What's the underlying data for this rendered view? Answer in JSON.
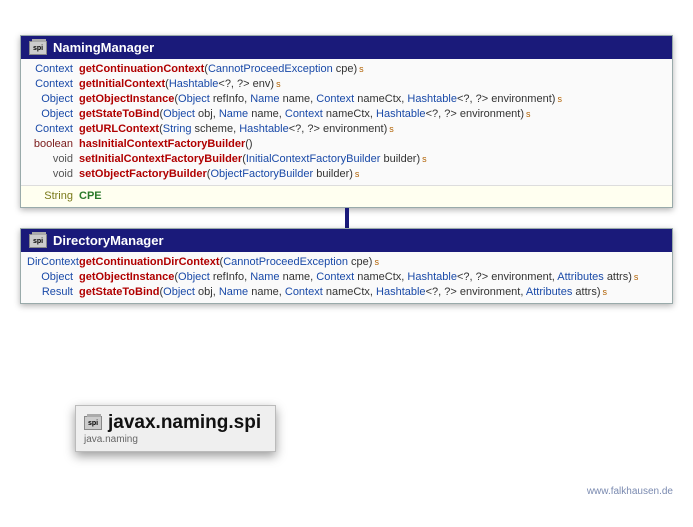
{
  "classes": [
    {
      "name": "NamingManager",
      "methods": [
        {
          "ret": "Context",
          "retKind": "type",
          "name": "getContinuationContext",
          "static": true,
          "params": [
            {
              "type": "CannotProceedException",
              "name": "cpe"
            }
          ]
        },
        {
          "ret": "Context",
          "retKind": "type",
          "name": "getInitialContext",
          "static": true,
          "params": [
            {
              "type": "Hashtable",
              "gen": "<?, ?>",
              "name": "env"
            }
          ]
        },
        {
          "ret": "Object",
          "retKind": "type",
          "name": "getObjectInstance",
          "static": true,
          "params": [
            {
              "type": "Object",
              "name": "refInfo"
            },
            {
              "type": "Name",
              "name": "name"
            },
            {
              "type": "Context",
              "name": "nameCtx"
            },
            {
              "type": "Hashtable",
              "gen": "<?, ?>",
              "name": "environment"
            }
          ]
        },
        {
          "ret": "Object",
          "retKind": "type",
          "name": "getStateToBind",
          "static": true,
          "params": [
            {
              "type": "Object",
              "name": "obj"
            },
            {
              "type": "Name",
              "name": "name"
            },
            {
              "type": "Context",
              "name": "nameCtx"
            },
            {
              "type": "Hashtable",
              "gen": "<?, ?>",
              "name": "environment"
            }
          ]
        },
        {
          "ret": "Context",
          "retKind": "type",
          "name": "getURLContext",
          "static": true,
          "params": [
            {
              "type": "String",
              "name": "scheme"
            },
            {
              "type": "Hashtable",
              "gen": "<?, ?>",
              "name": "environment"
            }
          ]
        },
        {
          "ret": "boolean",
          "retKind": "keyword",
          "name": "hasInitialContextFactoryBuilder",
          "static": false,
          "params": []
        },
        {
          "ret": "void",
          "retKind": "void",
          "name": "setInitialContextFactoryBuilder",
          "static": true,
          "params": [
            {
              "type": "InitialContextFactoryBuilder",
              "name": "builder"
            }
          ]
        },
        {
          "ret": "void",
          "retKind": "void",
          "name": "setObjectFactoryBuilder",
          "static": true,
          "params": [
            {
              "type": "ObjectFactoryBuilder",
              "name": "builder"
            }
          ]
        }
      ],
      "fields": [
        {
          "type": "String",
          "name": "CPE"
        }
      ]
    },
    {
      "name": "DirectoryManager",
      "methods": [
        {
          "ret": "DirContext",
          "retKind": "type",
          "name": "getContinuationDirContext",
          "static": true,
          "params": [
            {
              "type": "CannotProceedException",
              "name": "cpe"
            }
          ]
        },
        {
          "ret": "Object",
          "retKind": "type",
          "name": "getObjectInstance",
          "static": true,
          "params": [
            {
              "type": "Object",
              "name": "refInfo"
            },
            {
              "type": "Name",
              "name": "name"
            },
            {
              "type": "Context",
              "name": "nameCtx"
            },
            {
              "type": "Hashtable",
              "gen": "<?, ?>",
              "name": "environment"
            },
            {
              "type": "Attributes",
              "name": "attrs"
            }
          ]
        },
        {
          "ret": "Result",
          "retKind": "type",
          "name": "getStateToBind",
          "static": true,
          "params": [
            {
              "type": "Object",
              "name": "obj"
            },
            {
              "type": "Name",
              "name": "name"
            },
            {
              "type": "Context",
              "name": "nameCtx"
            },
            {
              "type": "Hashtable",
              "gen": "<?, ?>",
              "name": "environment"
            },
            {
              "type": "Attributes",
              "name": "attrs"
            }
          ]
        }
      ],
      "fields": []
    }
  ],
  "package": {
    "icon": "spi",
    "title": "javax.naming.spi",
    "module": "java.naming"
  },
  "footer": "www.falkhausen.de"
}
